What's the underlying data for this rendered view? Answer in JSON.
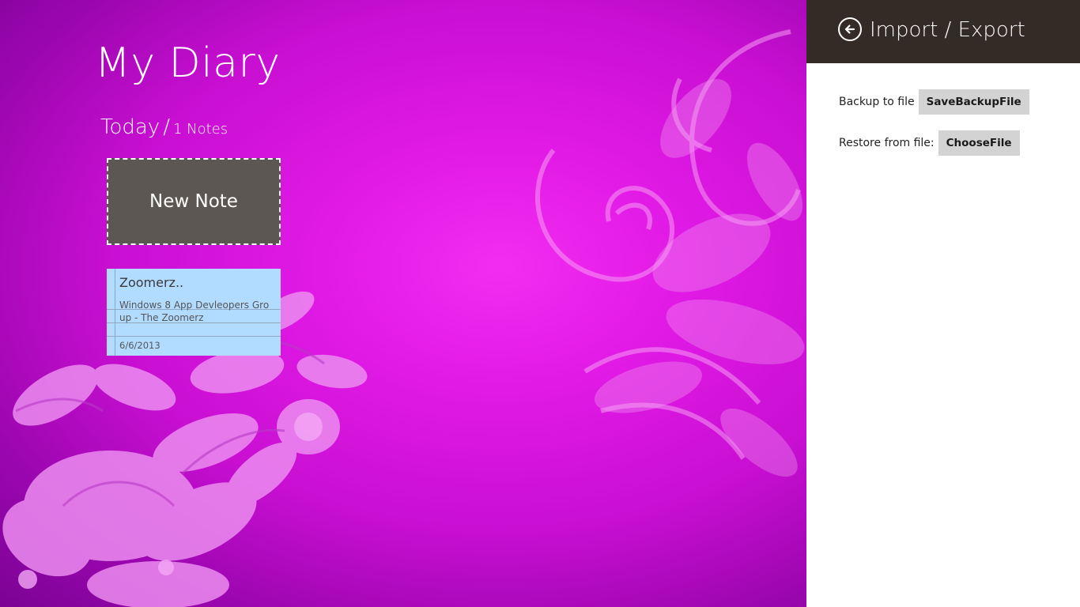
{
  "app": {
    "title": "My Diary"
  },
  "group": {
    "name": "Today",
    "separator": "/",
    "count_label": "1 Notes"
  },
  "new_note": {
    "label": "New Note"
  },
  "notes": [
    {
      "title": "Zoomerz..",
      "body": "Windows 8 App Devleopers Group - The Zoomerz",
      "date": "6/6/2013"
    }
  ],
  "flyout": {
    "title": "Import / Export",
    "back_icon": "back-arrow-circle-icon",
    "backup_label": "Backup to file",
    "backup_button": "SaveBackupFile",
    "restore_label": "Restore from file:",
    "restore_button": "ChooseFile"
  },
  "colors": {
    "background_accent": "#e21ae6",
    "flyout_header": "#342a26",
    "new_note_tile": "#5c5752",
    "note_card": "#b2dcff",
    "flyout_button": "#d3d3d3"
  }
}
